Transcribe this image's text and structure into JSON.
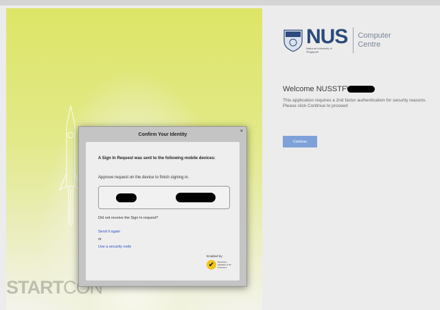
{
  "left_panel": {
    "start_text": "START",
    "con_text": "CON"
  },
  "logo": {
    "nus": "NUS",
    "nus_sub": "National University of Singapore",
    "unit": "Computer Centre"
  },
  "welcome": {
    "text": "Welcome NUSSTF\\"
  },
  "app_message": "This application requires a 2nd factor authentication for security reasons. Please click Continue to proceed",
  "continue_button": "Continue",
  "modal": {
    "title": "Confirm Your Identity",
    "close": "×",
    "sent_message": "A Sign In Request was sent to the following mobile devices:",
    "approve_message": "Approve request on the device to finish signing in.",
    "not_received": "Did not receive the Sign In request?",
    "send_again": "Send it again",
    "or": "or",
    "security_code": "Use a security code",
    "enabled_by": "Enabled by:",
    "symantec": "Symantec Validation & ID Protection"
  },
  "colors": {
    "panel_yellow": "#dde566",
    "nus_blue": "#2c4a7c",
    "link_blue": "#2a4fc6",
    "continue_blue": "#7ea2d8"
  }
}
